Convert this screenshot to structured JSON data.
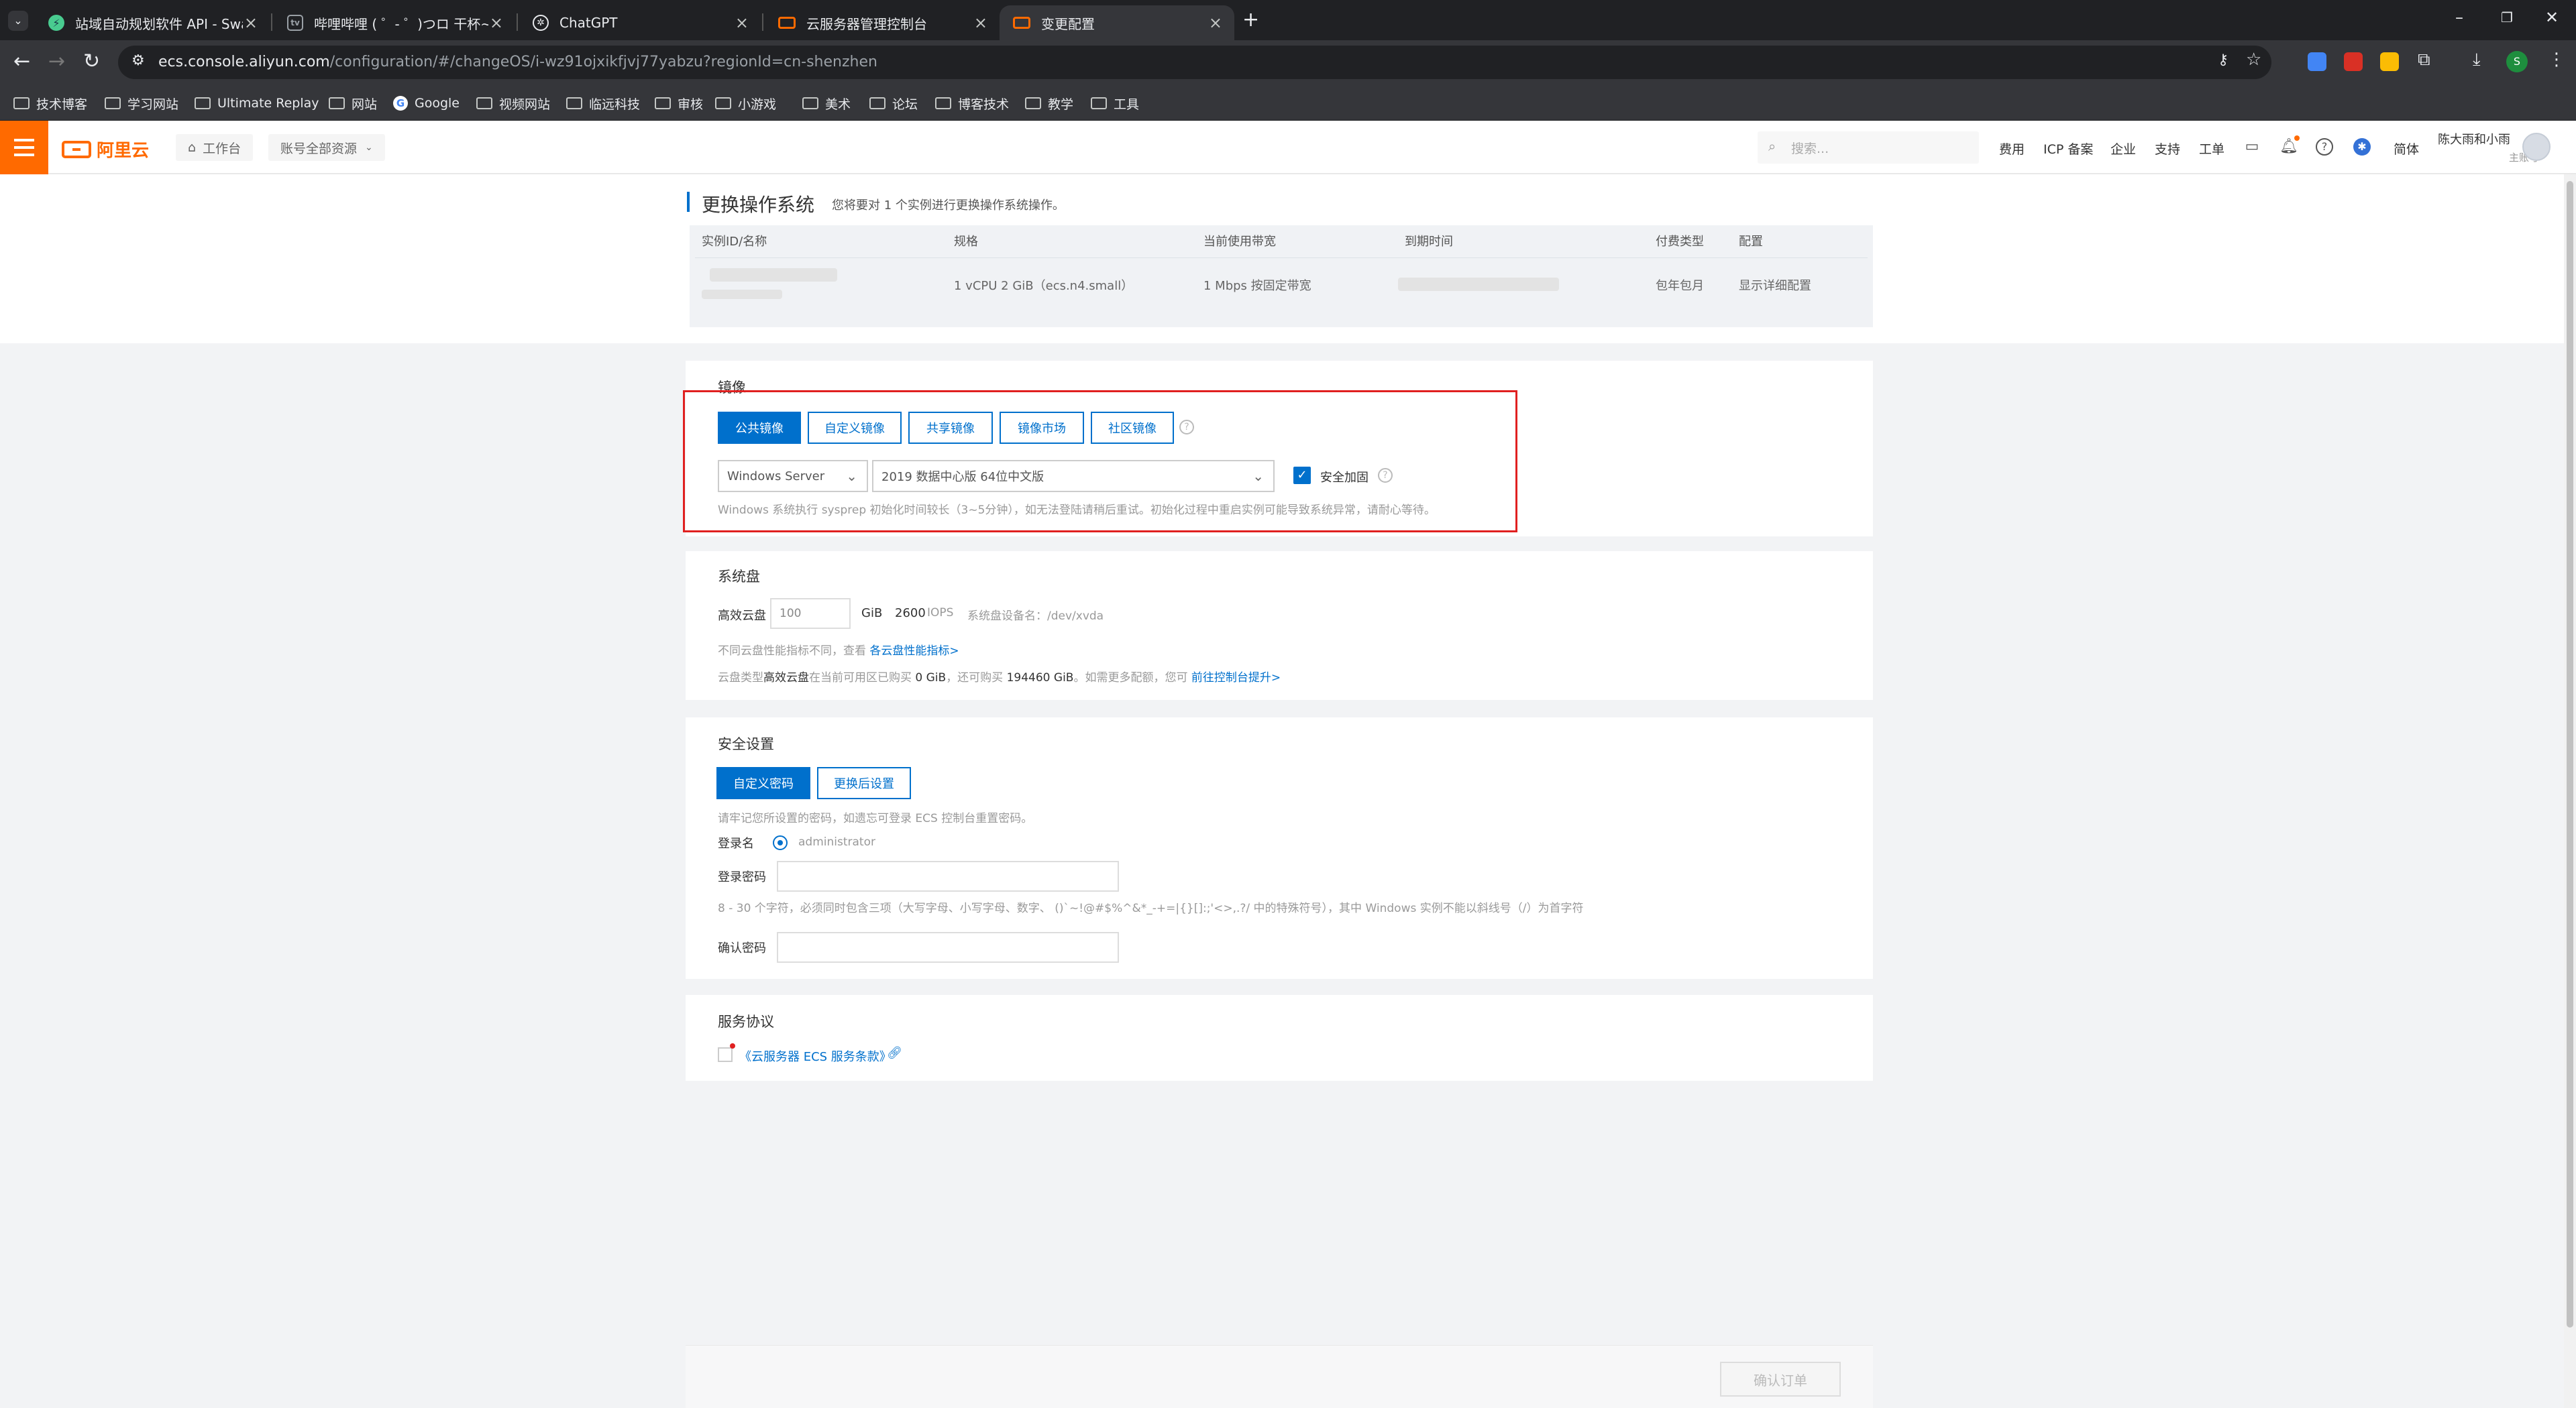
{
  "browser": {
    "tabs": [
      {
        "title": "站域自动规划软件 API - Swagg",
        "icon": "swagger-icon",
        "color": "#49cc90"
      },
      {
        "title": "哔哩哔哩 ( ゜- ゜)つロ 干杯~-bi",
        "icon": "bilibili-icon",
        "color": "#fb7299"
      },
      {
        "title": "ChatGPT",
        "icon": "chatgpt-icon",
        "color": "#ffffff"
      },
      {
        "title": "云服务器管理控制台",
        "icon": "aliyun-icon",
        "color": "#ff6a00"
      },
      {
        "title": "变更配置",
        "icon": "aliyun-icon",
        "color": "#ff6a00"
      }
    ],
    "active_tab": 4,
    "url_host": "ecs.console.aliyun.com",
    "url_path": "/configuration/#/changeOS/i-wz91ojxikfjvj77yabzu?regionId=cn-shenzhen",
    "bookmarks": [
      "技术博客",
      "学习网站",
      "Ultimate Replay",
      "网站",
      "Google",
      "视频网站",
      "临远科技",
      "审核",
      "小游戏",
      "美术",
      "论坛",
      "博客技术",
      "教学",
      "工具"
    ],
    "profile_initial": "S"
  },
  "console": {
    "logo_text": "阿里云",
    "workbench": "工作台",
    "resource_scope": "账号全部资源",
    "search_placeholder": "搜索...",
    "nav": [
      "费用",
      "ICP 备案",
      "企业",
      "支持",
      "工单"
    ],
    "lang": "简体",
    "user_name": "陈大雨和小雨",
    "user_role": "主账号"
  },
  "page": {
    "title": "更换操作系统",
    "subtitle": "您将要对 1 个实例进行更换操作系统操作。",
    "table": {
      "headers": [
        "实例ID/名称",
        "规格",
        "当前使用带宽",
        "到期时间",
        "付费类型",
        "配置"
      ],
      "row": {
        "spec": "1 vCPU 2 GiB（ecs.n4.small）",
        "bandwidth": "1 Mbps 按固定带宽",
        "pay_type": "包年包月",
        "config_link": "显示详细配置"
      }
    }
  },
  "image_section": {
    "title": "镜像",
    "tabs": [
      "公共镜像",
      "自定义镜像",
      "共享镜像",
      "镜像市场",
      "社区镜像"
    ],
    "selected_tab": 0,
    "os_select": "Windows Server",
    "version_select": "2019 数据中心版 64位中文版",
    "hardening_label": "安全加固",
    "hardening_checked": true,
    "note": "Windows 系统执行 sysprep 初始化时间较长（3~5分钟），如无法登陆请稍后重试。初始化过程中重启实例可能导致系统异常，请耐心等待。"
  },
  "disk_section": {
    "title": "系统盘",
    "disk_type": "高效云盘",
    "size": "100",
    "unit": "GiB",
    "iops_value": "2600",
    "iops_unit": "IOPS",
    "device_label": "系统盘设备名：/dev/xvda",
    "perf_hint": "不同云盘性能指标不同，查看",
    "perf_link": "各云盘性能指标>",
    "quota_prefix": "云盘类型",
    "quota_type": "高效云盘",
    "quota_mid1": "在当前可用区已购买",
    "quota_used": "0 GiB",
    "quota_mid2": "，还可购买",
    "quota_left": "194460 GiB",
    "quota_mid3": "。如需更多配额，您可",
    "quota_link": "前往控制台提升>"
  },
  "security_section": {
    "title": "安全设置",
    "tabs": [
      "自定义密码",
      "更换后设置"
    ],
    "selected_tab": 0,
    "tip": "请牢记您所设置的密码，如遗忘可登录 ECS 控制台重置密码。",
    "login_name_label": "登录名",
    "login_name": "administrator",
    "password_label": "登录密码",
    "password_rule": "8 - 30 个字符，必须同时包含三项（大写字母、小写字母、数字、 ()`~!@#$%^&*_-+=|{}[]:;'<>,.?/ 中的特殊符号），其中 Windows 实例不能以斜线号（/）为首字符",
    "confirm_label": "确认密码"
  },
  "agreement_section": {
    "title": "服务协议",
    "link": "《云服务器 ECS 服务条款》"
  },
  "footer": {
    "confirm_button": "确认订单"
  },
  "colors": {
    "brand": "#ff6a00",
    "primary": "#0070cc",
    "highlight_box": "#e02020"
  }
}
